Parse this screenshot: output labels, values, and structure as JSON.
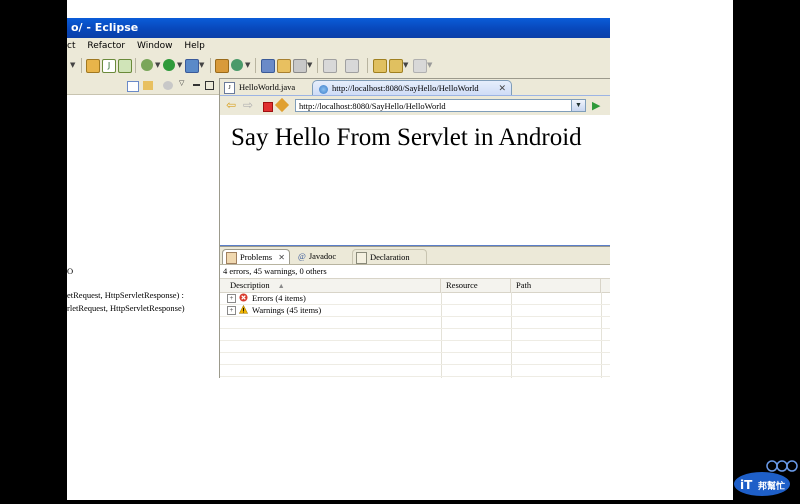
{
  "window": {
    "title": "o/ - Eclipse"
  },
  "menu": [
    "ct",
    "Refactor",
    "Window",
    "Help"
  ],
  "editor_tabs": [
    {
      "label": "HelloWorld.java"
    },
    {
      "label": "http://localhost:8080/SayHello/HelloWorld",
      "active": true
    }
  ],
  "browser": {
    "url": "http://localhost:8080/SayHello/HelloWorld",
    "page_text": "Say Hello From Servlet in Android"
  },
  "left_view": {
    "lines": [
      "O",
      "etRequest, HttpServletResponse) :",
      "rletRequest, HttpServletResponse)"
    ]
  },
  "bottom_tabs": [
    {
      "label": "Problems",
      "active": true
    },
    {
      "label": "Javadoc"
    },
    {
      "label": "Declaration"
    }
  ],
  "problems": {
    "summary": "4 errors, 45 warnings, 0 others",
    "columns": [
      "Description",
      "Resource",
      "Path"
    ],
    "rows": [
      {
        "label": "Errors (4 items)",
        "icon": "error-icon"
      },
      {
        "label": "Warnings (45 items)",
        "icon": "warning-icon"
      }
    ]
  },
  "logo": {
    "text": "iT邦幫忙"
  },
  "colors": {
    "titlebar": "#0846b8",
    "chrome": "#ece9d8",
    "error": "#d83a2c",
    "warning": "#f0b400"
  }
}
